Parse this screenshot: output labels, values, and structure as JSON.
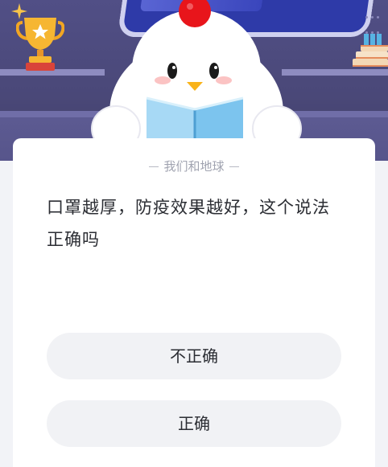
{
  "banner": {
    "icons": [
      "sparkle-icon",
      "trophy-icon",
      "mascot-illustration",
      "books-icon"
    ],
    "colors": {
      "background": "#4a4878",
      "trophy": "#f6b632",
      "comb": "#e8151b"
    }
  },
  "quiz": {
    "source_label": "我们和地球",
    "question": "口罩越厚，防疫效果越好，这个说法正确吗",
    "options": [
      {
        "label": "不正确"
      },
      {
        "label": "正确"
      }
    ]
  }
}
